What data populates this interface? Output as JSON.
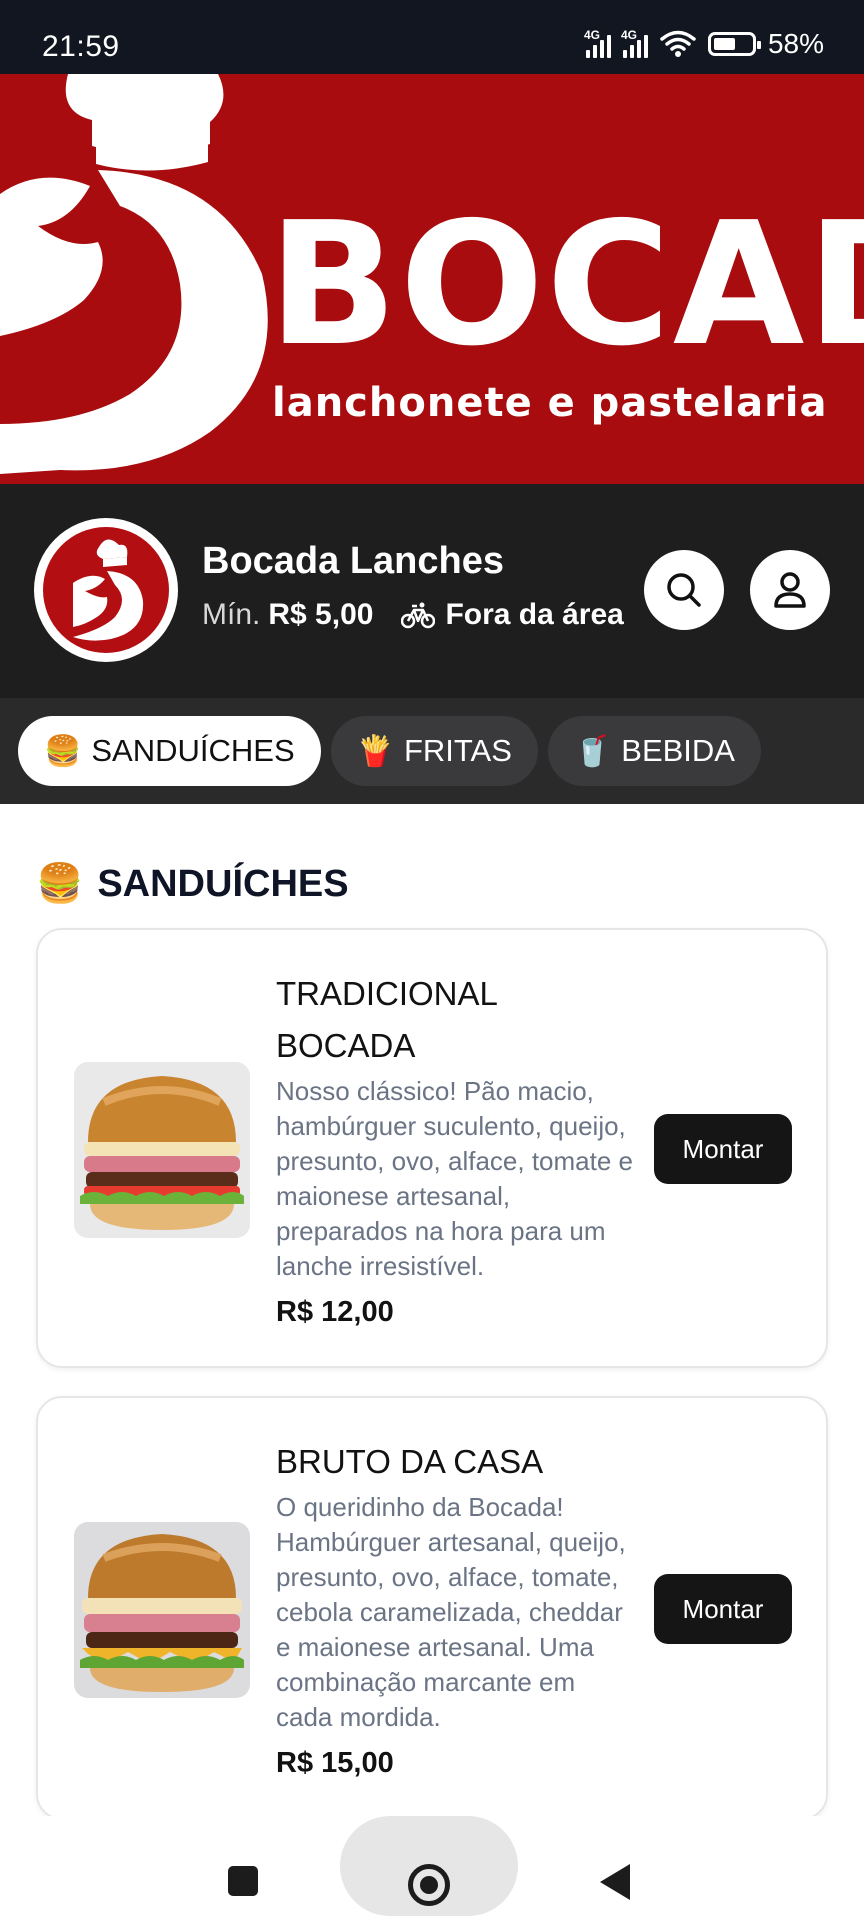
{
  "status_bar": {
    "time": "21:59",
    "network_1": "4G",
    "network_2": "4G",
    "battery_percent": "58%",
    "battery_level": 0.58,
    "icons": [
      "signal-icon",
      "wifi-icon",
      "battery-icon"
    ]
  },
  "banner": {
    "brand_word": "BOCADA",
    "subtitle": "Lanchonete e Pastelaria"
  },
  "store": {
    "name": "Bocada Lanches",
    "min_label": "Mín.",
    "min_value": "R$ 5,00",
    "delivery_status": "Fora da área",
    "icons": [
      "bicycle-icon",
      "search-icon",
      "user-icon"
    ]
  },
  "categories": [
    {
      "emoji": "🍔",
      "label": "SANDUÍCHES",
      "active": true
    },
    {
      "emoji": "🍟",
      "label": "FRITAS",
      "active": false
    },
    {
      "emoji": "🥤",
      "label": "BEBIDA",
      "active": false
    }
  ],
  "section": {
    "emoji": "🍔",
    "title": "SANDUÍCHES"
  },
  "products": [
    {
      "name": "TRADICIONAL BOCADA",
      "description": "Nosso clássico! Pão macio, hambúrguer suculento, queijo, presunto, ovo, alface, tomate e maionese artesanal, preparados na hora para um lanche irresistível.",
      "price": "R$ 12,00",
      "button": "Montar"
    },
    {
      "name": "BRUTO DA CASA",
      "description": "O queridinho da Bocada! Hambúrguer artesanal, queijo, presunto, ovo, alface, tomate, cebola caramelizada, cheddar e maionese artesanal. Uma combinação marcante em cada mordida.",
      "price": "R$ 15,00",
      "button": "Montar"
    }
  ],
  "colors": {
    "brand_red": "#a80c0f",
    "header_dark": "#1e1e1e",
    "tabs_bg": "#2a2a2b",
    "button_dark": "#151515"
  }
}
